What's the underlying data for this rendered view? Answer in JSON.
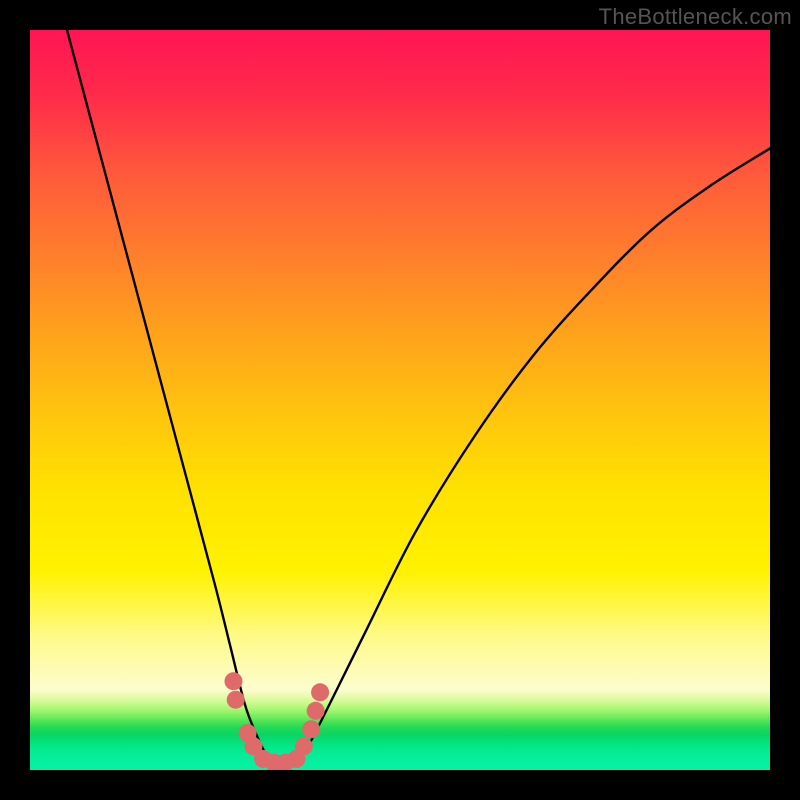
{
  "watermark": "TheBottleneck.com",
  "chart_data": {
    "type": "line",
    "title": "",
    "xlabel": "",
    "ylabel": "",
    "xlim": [
      0,
      100
    ],
    "ylim": [
      0,
      100
    ],
    "series": [
      {
        "name": "bottleneck-curve",
        "x": [
          5,
          9,
          13,
          17,
          21,
          25,
          27,
          29,
          30.5,
          32,
          33.5,
          35,
          36.5,
          38,
          45,
          52,
          60,
          68,
          76,
          84,
          92,
          100
        ],
        "values": [
          100,
          85,
          70,
          55,
          40,
          25,
          17,
          9,
          5,
          2,
          1,
          1,
          2,
          4,
          18,
          32,
          45,
          56,
          65,
          73,
          79,
          84
        ]
      }
    ],
    "markers": {
      "name": "highlight-dots",
      "color": "#de6a6a",
      "points": [
        {
          "x": 27.5,
          "y": 12
        },
        {
          "x": 27.8,
          "y": 9.5
        },
        {
          "x": 29.4,
          "y": 5
        },
        {
          "x": 30.2,
          "y": 3.2
        },
        {
          "x": 31.5,
          "y": 1.5
        },
        {
          "x": 33.0,
          "y": 1.0
        },
        {
          "x": 34.5,
          "y": 1.0
        },
        {
          "x": 36.0,
          "y": 1.5
        },
        {
          "x": 37.0,
          "y": 3.2
        },
        {
          "x": 38.0,
          "y": 5.5
        },
        {
          "x": 38.6,
          "y": 8.0
        },
        {
          "x": 39.2,
          "y": 10.5
        }
      ]
    },
    "gradient_bands": [
      {
        "y": 100,
        "color": "#ff1554"
      },
      {
        "y": 50,
        "color": "#ffc40e"
      },
      {
        "y": 15,
        "color": "#fffa8a"
      },
      {
        "y": 0,
        "color": "#08f1a4"
      }
    ]
  }
}
